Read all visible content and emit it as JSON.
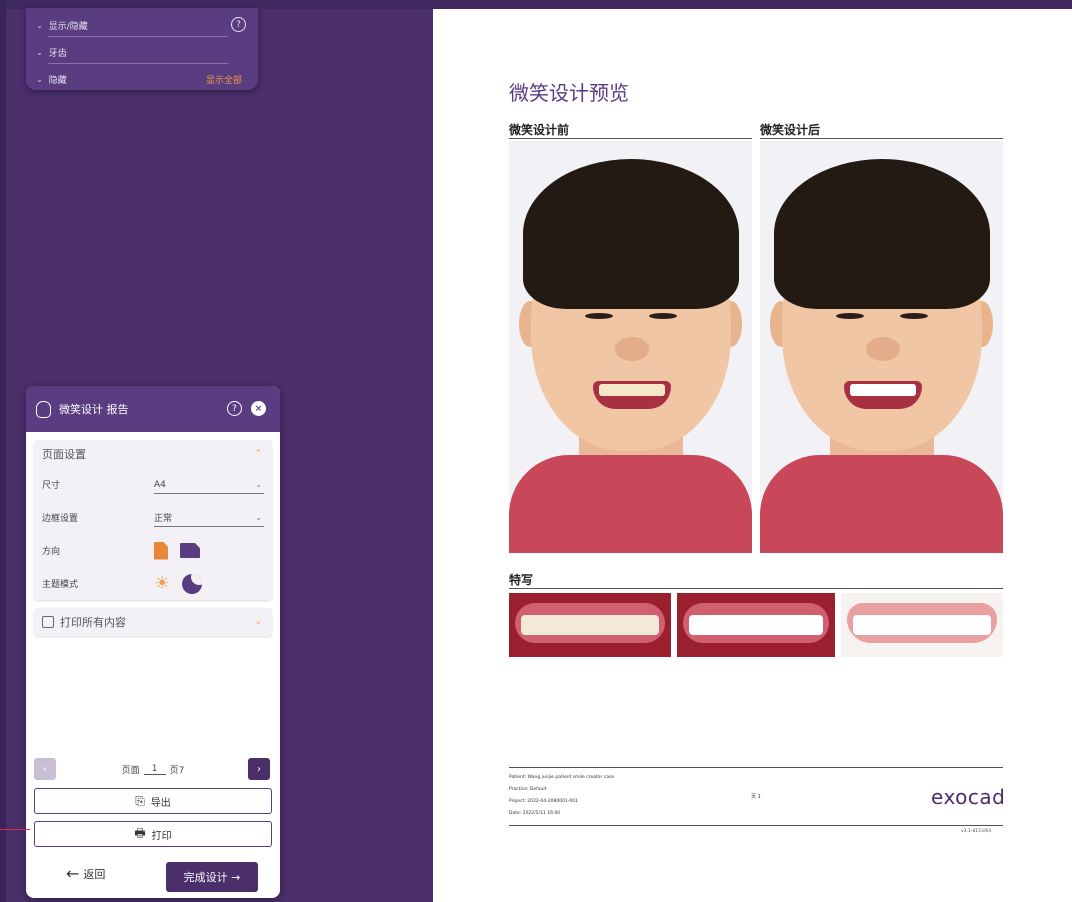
{
  "visibility_panel": {
    "rows": [
      {
        "label": "显示/隐藏"
      },
      {
        "label": "牙齿"
      },
      {
        "label": "隐藏"
      }
    ],
    "help": "?",
    "show_all_label": "显示全部"
  },
  "report_panel": {
    "title": "微笑设计 报告",
    "help": "?",
    "close": "×",
    "page_settings": {
      "title": "页面设置",
      "size_label": "尺寸",
      "size_value": "A4",
      "margin_label": "边框设置",
      "margin_value": "正常",
      "orientation_label": "方向",
      "theme_label": "主题模式"
    },
    "print_all_label": "打印所有内容",
    "pager": {
      "page_prefix": "页面",
      "current_page": "1",
      "page_total": "页7"
    },
    "export_label": "导出",
    "print_label": "打印",
    "back_label": "返回",
    "finish_label": "完成设计 →"
  },
  "document": {
    "title": "微笑设计预览",
    "before_caption": "微笑设计前",
    "after_caption": "微笑设计后",
    "closeup_caption": "特写",
    "footer": {
      "patient": "Patient:   Wang junjie patient smile creator case",
      "practice": "Practice:  Default",
      "project": "Project:   2022-04-2080001-001",
      "date": "Date:       2022/5/11 16:00",
      "page": "页 1",
      "logo": "exocad",
      "version": "v3.1-8153/64"
    }
  }
}
